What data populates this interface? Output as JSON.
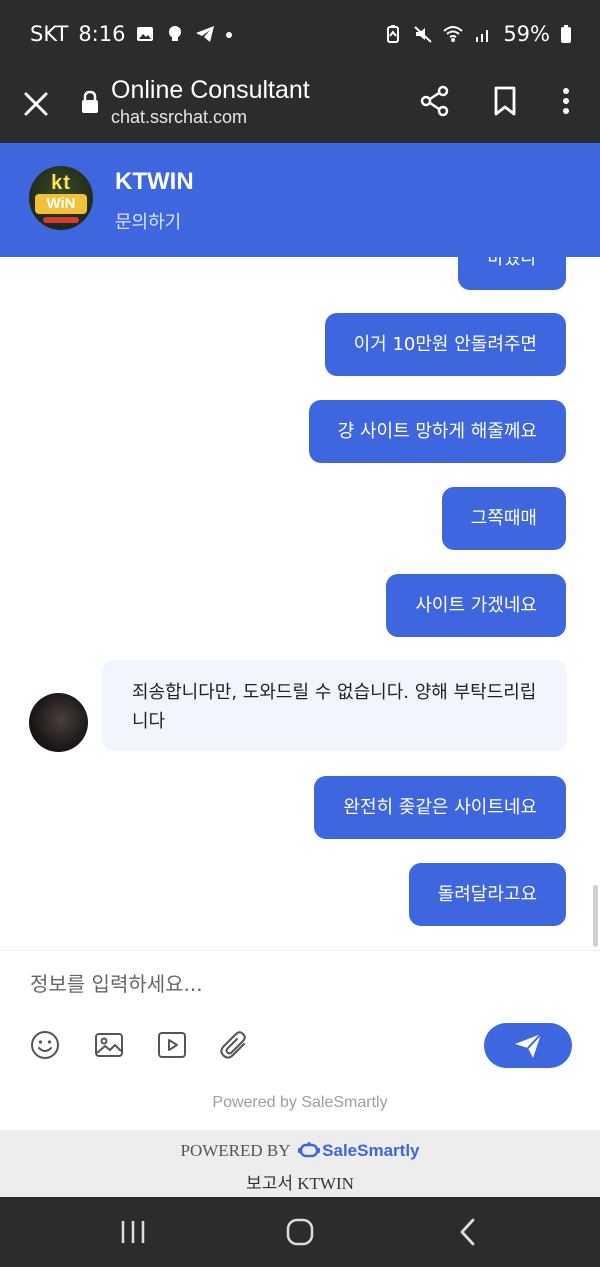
{
  "status_bar": {
    "carrier": "SKT",
    "time": "8:16",
    "battery": "59%",
    "left_icons": [
      "gallery-icon",
      "bulb-icon",
      "telegram-icon",
      "dot-icon"
    ],
    "right_icons": [
      "battery-saver-icon",
      "mute-icon",
      "wifi-icon",
      "signal-icon",
      "battery-icon"
    ]
  },
  "browser": {
    "title": "Online Consultant",
    "host": "chat.ssrchat.com"
  },
  "chat_header": {
    "name": "KTWIN",
    "subtitle": "문의하기",
    "logo_text_top": "kt",
    "logo_text_bottom": "WiN"
  },
  "messages": [
    {
      "direction": "out",
      "text": "바꿨다",
      "partial": true
    },
    {
      "direction": "out",
      "text": "이거 10만원 안돌려주면"
    },
    {
      "direction": "out",
      "text": "걍 사이트 망하게 해줄께요"
    },
    {
      "direction": "out",
      "text": "그쪽때매"
    },
    {
      "direction": "out",
      "text": "사이트 가겠네요"
    },
    {
      "direction": "in",
      "text": "죄송합니다만, 도와드릴 수 없습니다. 양해 부탁드리립니다"
    },
    {
      "direction": "out",
      "text": "완전히 좆같은 사이트네요"
    },
    {
      "direction": "out",
      "text": "돌려달라고요"
    }
  ],
  "composer": {
    "placeholder": "정보를 입력하세요...",
    "tools": [
      "emoji-icon",
      "image-icon",
      "video-icon",
      "attachment-icon"
    ],
    "send_icon": "send-icon"
  },
  "powered_small": "Powered by SaleSmartly",
  "footer": {
    "powered_by": "POWERED BY",
    "brand": "SaleSmartly",
    "report": "보고서 KTWIN"
  },
  "colors": {
    "accent": "#3e66df",
    "dark_bar": "#2b2c2e",
    "incoming_bubble": "#f1f5fd"
  }
}
